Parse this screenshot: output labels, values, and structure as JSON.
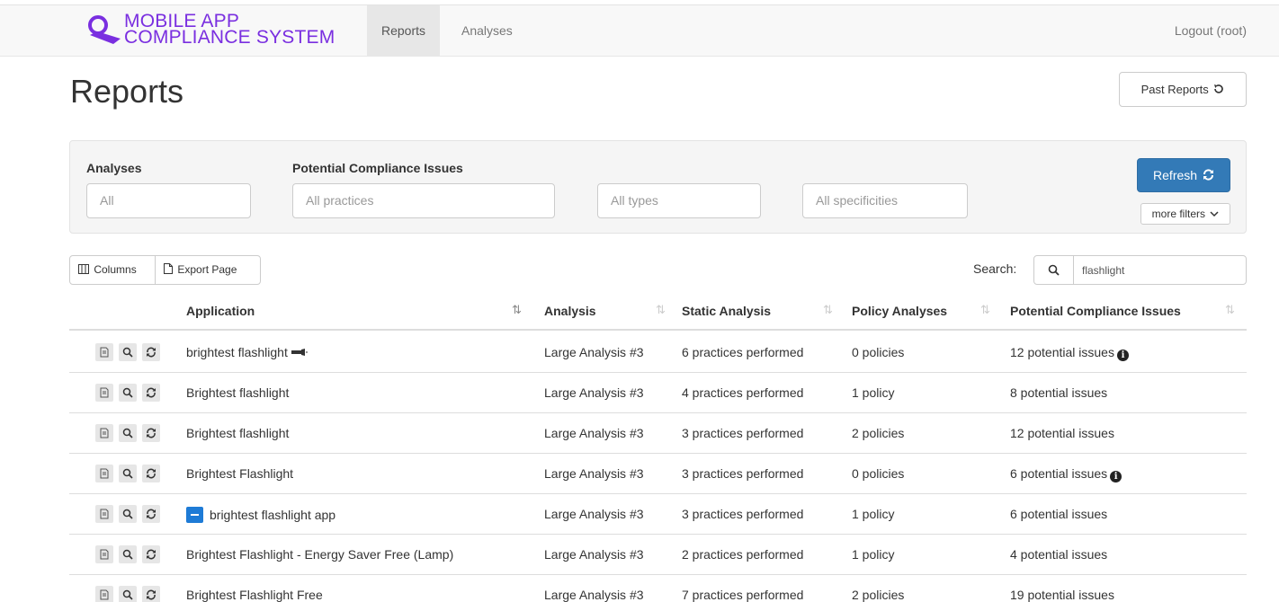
{
  "app": {
    "brand_line1": "MOBILE APP",
    "brand_line2": "COMPLIANCE SYSTEM",
    "brand_color": "#7a2fe0",
    "accent": "#337ab7"
  },
  "nav": {
    "items": [
      {
        "label": "Reports",
        "active": true
      },
      {
        "label": "Analyses",
        "active": false
      }
    ],
    "logout": "Logout (root)"
  },
  "page": {
    "title": "Reports",
    "past_reports": "Past Reports"
  },
  "filters": {
    "analyses_label": "Analyses",
    "issues_label": "Potential Compliance Issues",
    "analyses_placeholder": "All",
    "practices_placeholder": "All practices",
    "types_placeholder": "All types",
    "specificities_placeholder": "All specificities",
    "refresh": "Refresh",
    "more_filters": "more filters"
  },
  "toolbar": {
    "columns": "Columns",
    "export": "Export Page",
    "search_label": "Search:",
    "search_value": "flashlight"
  },
  "table": {
    "headers": [
      "Application",
      "Analysis",
      "Static Analysis",
      "Policy Analyses",
      "Potential Compliance Issues"
    ],
    "rows": [
      {
        "app": "brightest flashlight",
        "analysis": "Large Analysis #3",
        "static": "6 practices performed",
        "policy": "0 policies",
        "issues": "12 potential issues"
      },
      {
        "app": "Brightest flashlight",
        "analysis": "Large Analysis #3",
        "static": "4 practices performed",
        "policy": "1 policy",
        "issues": "8 potential issues"
      },
      {
        "app": "Brightest flashlight",
        "analysis": "Large Analysis #3",
        "static": "3 practices performed",
        "policy": "2 policies",
        "issues": "12 potential issues"
      },
      {
        "app": "Brightest Flashlight",
        "analysis": "Large Analysis #3",
        "static": "3 practices performed",
        "policy": "0 policies",
        "issues": "6 potential issues"
      },
      {
        "app": "brightest flashlight app",
        "analysis": "Large Analysis #3",
        "static": "3 practices performed",
        "policy": "1 policy",
        "issues": "6 potential issues"
      },
      {
        "app": "Brightest Flashlight - Energy Saver Free (Lamp)",
        "analysis": "Large Analysis #3",
        "static": "2 practices performed",
        "policy": "1 policy",
        "issues": "4 potential issues"
      },
      {
        "app": "Brightest Flashlight Free",
        "analysis": "Large Analysis #3",
        "static": "7 practices performed",
        "policy": "2 policies",
        "issues": "19 potential issues"
      }
    ]
  }
}
